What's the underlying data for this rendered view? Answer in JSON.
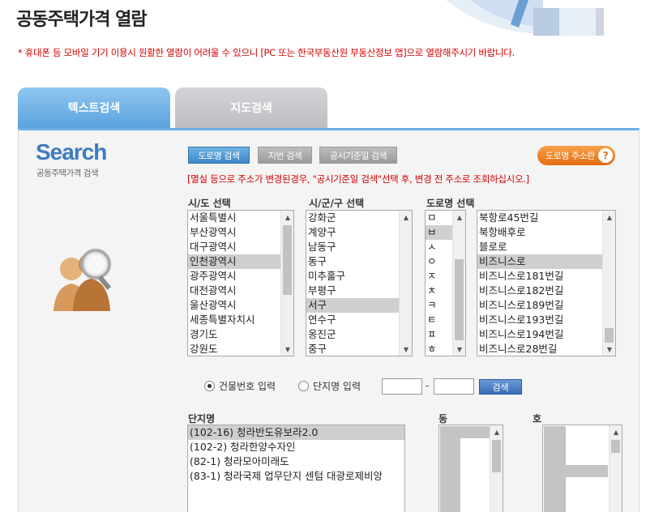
{
  "page": {
    "title": "공동주택가격 열람",
    "notice": "* 휴대폰 등 모바일 기기 이용시 원활한 열람이 어려울 수 있으니 [PC 또는 한국부동산원 부동산정보 앱]으로 열람해주시기 바랍니다."
  },
  "tabs": {
    "text_search": "텍스트검색",
    "map_search": "지도검색"
  },
  "logo": {
    "title": "Search",
    "subtitle": "공동주택가격 검색"
  },
  "search_buttons": {
    "road": "도로명 검색",
    "lot": "지번 검색",
    "date": "공시기준일 검색",
    "address_help": "도로명 주소란",
    "help_glyph": "?"
  },
  "warning": "[멸실 등으로 주소가 변경된경우, \"공시기준일 검색\"선택 후, 변경 전 주소로 조회하십시오.]",
  "labels": {
    "sido": "시/도 선택",
    "sigungu": "시/군/구 선택",
    "road": "도로명 선택",
    "complex": "단지명",
    "dong": "동",
    "ho": "호"
  },
  "lists": {
    "sido": [
      "서울특별시",
      "부산광역시",
      "대구광역시",
      "인천광역시",
      "광주광역시",
      "대전광역시",
      "울산광역시",
      "세종특별자치시",
      "경기도",
      "강원도"
    ],
    "sigungu": [
      "강화군",
      "계양구",
      "남동구",
      "동구",
      "미추홀구",
      "부평구",
      "서구",
      "연수구",
      "옹진군",
      "중구"
    ],
    "initial": [
      "ㅁ",
      "ㅂ",
      "ㅅ",
      "ㅇ",
      "ㅈ",
      "ㅊ",
      "ㅋ",
      "ㅌ",
      "ㅍ",
      "ㅎ"
    ],
    "road": [
      "북항로45번길",
      "북항배후로",
      "블로로",
      "비즈니스로",
      "비즈니스로181번길",
      "비즈니스로182번길",
      "비즈니스로189번길",
      "비즈니스로193번길",
      "비즈니스로194번길",
      "비즈니스로28번길"
    ],
    "complex": [
      "(102-16) 청라반도유보라2.0",
      "(102-2) 청라한양수자인",
      "(82-1) 청라모아미래도",
      "(83-1) 청라국제 업무단지 센텀 대광로제비앙"
    ]
  },
  "input_mode": {
    "building": "건물번호 입력",
    "complex": "단지명 입력",
    "dash": "-",
    "search": "검색"
  },
  "colors": {
    "accent": "#5aa3de",
    "warning": "#d40000",
    "orange": "#e56d10"
  }
}
